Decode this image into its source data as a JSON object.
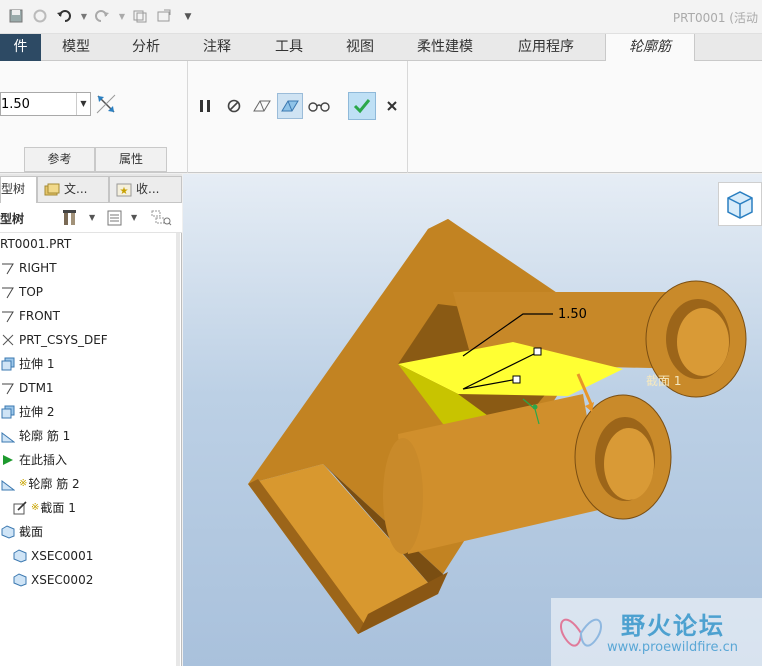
{
  "window": {
    "title": "PRT0001 (活动"
  },
  "tabs": [
    {
      "label": "件"
    },
    {
      "label": "模型"
    },
    {
      "label": "分析"
    },
    {
      "label": "注释"
    },
    {
      "label": "工具"
    },
    {
      "label": "视图"
    },
    {
      "label": "柔性建模"
    },
    {
      "label": "应用程序"
    },
    {
      "label": "轮廓筋"
    }
  ],
  "ribbon": {
    "thickness_value": "1.50",
    "subtabs": [
      {
        "label": "参考"
      },
      {
        "label": "属性"
      }
    ]
  },
  "panel": {
    "tabs": [
      {
        "label": "模型树"
      },
      {
        "label": "文..."
      },
      {
        "label": "收..."
      }
    ],
    "tree_header": "型树"
  },
  "tree": {
    "items": [
      {
        "label": "RT0001.PRT"
      },
      {
        "label": "RIGHT"
      },
      {
        "label": "TOP"
      },
      {
        "label": "FRONT"
      },
      {
        "label": "PRT_CSYS_DEF"
      },
      {
        "label": "拉伸 1"
      },
      {
        "label": "DTM1"
      },
      {
        "label": "拉伸 2"
      },
      {
        "label": "轮廓 筋 1"
      },
      {
        "label": "在此插入"
      },
      {
        "label": "轮廓 筋 2"
      },
      {
        "label": "截面 1"
      },
      {
        "label": "截面"
      },
      {
        "label": "XSEC0001"
      },
      {
        "label": "XSEC0002"
      }
    ]
  },
  "viewport": {
    "dimension_label": "1.50",
    "section_label": "截面 1"
  },
  "watermark": {
    "name": "野火论坛",
    "url": "www.proewildfire.cn"
  },
  "colors": {
    "file_tab": "#2d4a64",
    "model_face": "#d08f2c",
    "model_shadow": "#8a5a14",
    "rib_highlight": "#ffff33",
    "accept_green": "#2aa84a"
  },
  "icons": {
    "ok": "check-icon",
    "cancel": "close-icon",
    "pause": "pause-icon"
  }
}
